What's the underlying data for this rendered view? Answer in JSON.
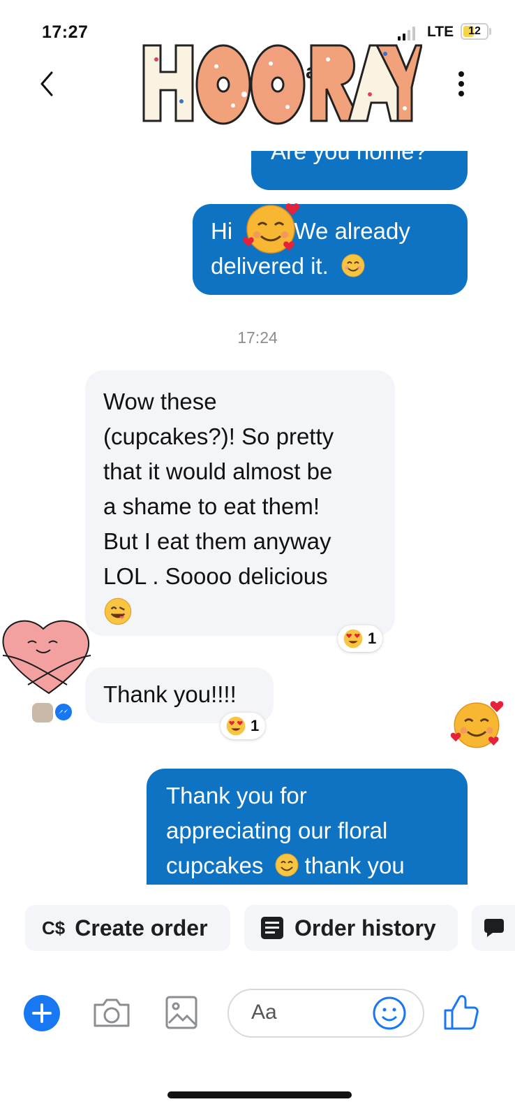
{
  "status_bar": {
    "time": "17:27",
    "network": "LTE",
    "battery": "12"
  },
  "header": {
    "sticker_text": "HOORAY",
    "visible_name_fragment": "an"
  },
  "messages": {
    "partial_out": "Are you home?",
    "out1": {
      "pre": "Hi",
      "post": ". We already",
      "line2": "delivered it."
    },
    "timestamp": "17:24",
    "in1_lines": [
      "Wow these",
      "(cupcakes?)! So pretty",
      "that it would almost be",
      "a shame to eat them!",
      "But I eat them anyway",
      "LOL . Soooo delicious"
    ],
    "in1_reaction_count": "1",
    "in2": "Thank you!!!!",
    "in2_reaction_count": "1",
    "out2_lines": [
      "Thank you for",
      "appreciating our floral",
      "thank you"
    ],
    "out2_line3_pre": "cupcakes"
  },
  "quick_replies": {
    "create_order_icon": "C$",
    "create_order": "Create order",
    "order_history": "Order history"
  },
  "composer": {
    "placeholder": "Aa"
  },
  "colors": {
    "accent": "#0f73c4",
    "incoming_bg": "#f4f5f8",
    "messenger_blue": "#1877f2"
  }
}
